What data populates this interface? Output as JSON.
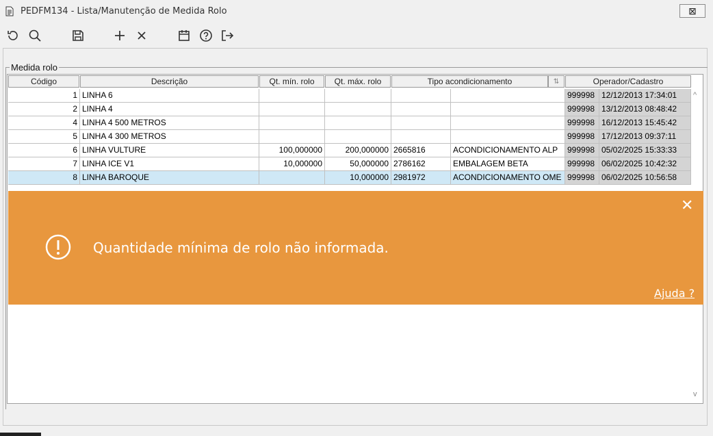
{
  "window": {
    "title": "PEDFM134 - Lista/Manutenção de Medida Rolo",
    "close_icon": "close-icon"
  },
  "toolbar": {
    "icons": [
      "refresh-icon",
      "search-icon",
      "save-icon",
      "add-icon",
      "delete-icon",
      "calendar-icon",
      "help-icon",
      "exit-icon"
    ]
  },
  "group": {
    "label": "Medida rolo"
  },
  "columns": [
    "Código",
    "Descrição",
    "Qt. mín. rolo",
    "Qt. máx. rolo",
    "Tipo acondicionamento",
    "Operador/Cadastro"
  ],
  "rows": [
    {
      "codigo": "1",
      "descricao": "LINHA 6",
      "qt_min": "",
      "qt_max": "",
      "tipo_cod": "",
      "tipo_desc": "",
      "operador": "999998",
      "cadastro": "12/12/2013 17:34:01"
    },
    {
      "codigo": "2",
      "descricao": "LINHA 4",
      "qt_min": "",
      "qt_max": "",
      "tipo_cod": "",
      "tipo_desc": "",
      "operador": "999998",
      "cadastro": "13/12/2013 08:48:42"
    },
    {
      "codigo": "4",
      "descricao": "LINHA 4 500 METROS",
      "qt_min": "",
      "qt_max": "",
      "tipo_cod": "",
      "tipo_desc": "",
      "operador": "999998",
      "cadastro": "16/12/2013 15:45:42"
    },
    {
      "codigo": "5",
      "descricao": "LINHA 4 300 METROS",
      "qt_min": "",
      "qt_max": "",
      "tipo_cod": "",
      "tipo_desc": "",
      "operador": "999998",
      "cadastro": "17/12/2013 09:37:11"
    },
    {
      "codigo": "6",
      "descricao": "LINHA VULTURE",
      "qt_min": "100,000000",
      "qt_max": "200,000000",
      "tipo_cod": "2665816",
      "tipo_desc": "ACONDICIONAMENTO ALP",
      "operador": "999998",
      "cadastro": "05/02/2025 15:33:33"
    },
    {
      "codigo": "7",
      "descricao": "LINHA ICE V1",
      "qt_min": "10,000000",
      "qt_max": "50,000000",
      "tipo_cod": "2786162",
      "tipo_desc": "EMBALAGEM BETA",
      "operador": "999998",
      "cadastro": "06/02/2025 10:42:32"
    },
    {
      "codigo": "8",
      "descricao": "LINHA BAROQUE",
      "qt_min": "",
      "qt_max": "10,000000",
      "tipo_cod": "2981972",
      "tipo_desc": "ACONDICIONAMENTO OME",
      "operador": "999998",
      "cadastro": "06/02/2025 10:56:58"
    }
  ],
  "toast": {
    "message": "Quantidade mínima de rolo não informada.",
    "help_link": "Ajuda ?",
    "close": "✕",
    "color": "#e8973e"
  }
}
